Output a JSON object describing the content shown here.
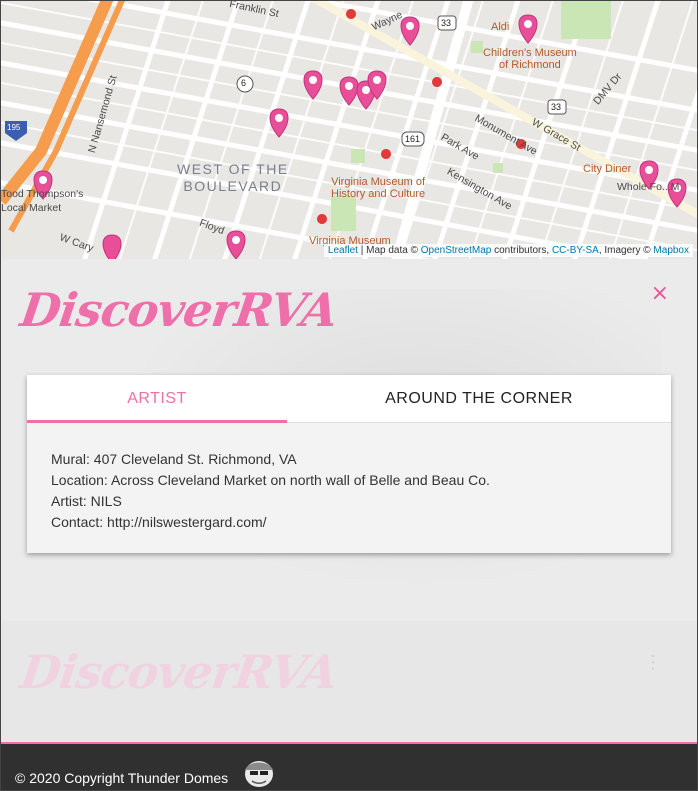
{
  "map": {
    "labels": {
      "franklin": "Franklin St",
      "wayne": "Wayne",
      "aldi": "Aldi",
      "childrens_museum": "Children's Museum\nof Richmond",
      "dmv": "DMV Dr",
      "nansemond": "N Nansemond St",
      "district": "WEST OF THE\nBOULEVARD",
      "thompson": "Tood Thompson's\nLocal Market",
      "vmhc": "Virginia Museum of\nHistory and Culture",
      "park_ave": "Park Ave",
      "monument_ave": "Monument Ave",
      "grace": "W Grace St",
      "kensington": "Kensington Ave",
      "city_diner": "City Diner",
      "whole_foods": "Whole Fo...M",
      "floyd": "Floyd",
      "cary": "W Cary",
      "vmfa": "Virginia Museum",
      "shield_6": "6",
      "shield_33a": "33",
      "shield_33b": "33",
      "shield_161": "161",
      "shield_195": "195"
    },
    "attribution": {
      "leaflet": "Leaflet",
      "sep1": " | Map data © ",
      "osm": "OpenStreetMap",
      "contrib": " contributors, ",
      "license": "CC-BY-SA",
      "imagery": ", Imagery © ",
      "mapbox": "Mapbox"
    }
  },
  "panel": {
    "brand": "DiscoverRVA",
    "close_icon": "×",
    "tabs": [
      {
        "label": "ARTIST",
        "active": true
      },
      {
        "label": "AROUND THE CORNER",
        "active": false
      }
    ],
    "info": {
      "mural": "Mural: 407 Cleveland St. Richmond, VA",
      "location": "Location: Across Cleveland Market on north wall of Belle and Beau Co.",
      "artist": "Artist: NILS",
      "contact": "Contact: http://nilswestergard.com/"
    }
  },
  "lower": {
    "brand": "DiscoverRVA",
    "menu_icon": "⋮"
  },
  "footer": {
    "copyright": "© 2020 Copyright Thunder Domes"
  },
  "colors": {
    "accent": "#ee6faa",
    "pin": "#e94f98",
    "footer_bg": "#303030"
  }
}
